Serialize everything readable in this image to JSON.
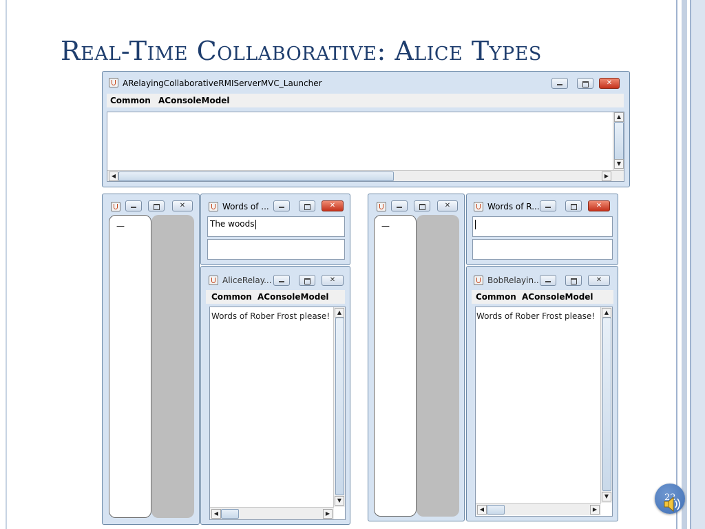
{
  "slide": {
    "title": "Real-Time Collaborative: Alice Types",
    "page_number": "22"
  },
  "server_window": {
    "title": "ARelayingCollaborativeRMIServerMVC_Launcher",
    "menu": [
      "Common",
      "AConsoleModel"
    ]
  },
  "left_group": {
    "words_window": {
      "title": "Words of ...",
      "input_value": "The woods",
      "second_input_value": ""
    },
    "relay_window": {
      "title": "AliceRelay...",
      "menu": [
        "Common",
        "AConsoleModel"
      ],
      "console_text": "Words of Rober Frost please!"
    },
    "tree_window": {
      "tree_item": "—"
    }
  },
  "right_group": {
    "words_window": {
      "title": "Words of R...",
      "input_value": "",
      "second_input_value": ""
    },
    "relay_window": {
      "title": "BobRelayin...",
      "menu": [
        "Common",
        "AConsoleModel"
      ],
      "console_text": "Words of Rober Frost please!"
    },
    "tree_window": {
      "tree_item": "—"
    }
  },
  "icons": [
    "java-icon",
    "minimize-icon",
    "maximize-icon",
    "close-icon",
    "speaker-icon"
  ],
  "colors": {
    "title": "#1f3e6e",
    "window_frame": "#d6e3f2",
    "close_button": "#c4321c",
    "speaker_badge": "#3f6fb5"
  }
}
